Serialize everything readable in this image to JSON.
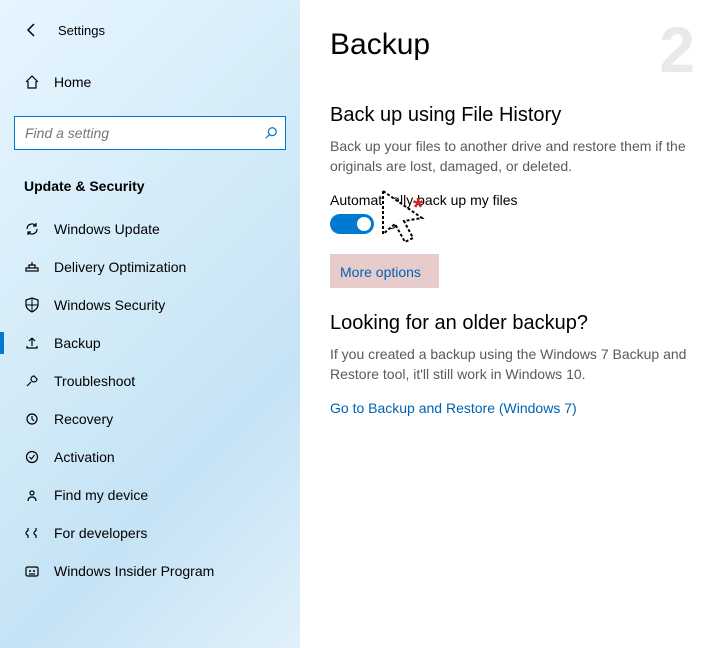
{
  "header": {
    "window_title": "Settings"
  },
  "home": {
    "label": "Home"
  },
  "search": {
    "placeholder": "Find a setting"
  },
  "section": {
    "heading": "Update & Security"
  },
  "sidebar": {
    "items": [
      {
        "label": "Windows Update",
        "icon": "sync-icon"
      },
      {
        "label": "Delivery Optimization",
        "icon": "delivery-icon"
      },
      {
        "label": "Windows Security",
        "icon": "shield-icon"
      },
      {
        "label": "Backup",
        "icon": "backup-icon"
      },
      {
        "label": "Troubleshoot",
        "icon": "troubleshoot-icon"
      },
      {
        "label": "Recovery",
        "icon": "recovery-icon"
      },
      {
        "label": "Activation",
        "icon": "activation-icon"
      },
      {
        "label": "Find my device",
        "icon": "find-device-icon"
      },
      {
        "label": "For developers",
        "icon": "developers-icon"
      },
      {
        "label": "Windows Insider Program",
        "icon": "insider-icon"
      }
    ],
    "selected_index": 3
  },
  "main": {
    "step_number": "2",
    "title": "Backup",
    "file_history": {
      "heading": "Back up using File History",
      "description": "Back up your files to another drive and restore them if the originals are lost, damaged, or deleted.",
      "toggle_label": "Automatically back up my files",
      "toggle_state": "On",
      "more_options": "More options"
    },
    "older": {
      "heading": "Looking for an older backup?",
      "description": "If you created a backup using the Windows 7 Backup and Restore tool, it'll still work in Windows 10.",
      "link": "Go to Backup and Restore (Windows 7)"
    }
  }
}
